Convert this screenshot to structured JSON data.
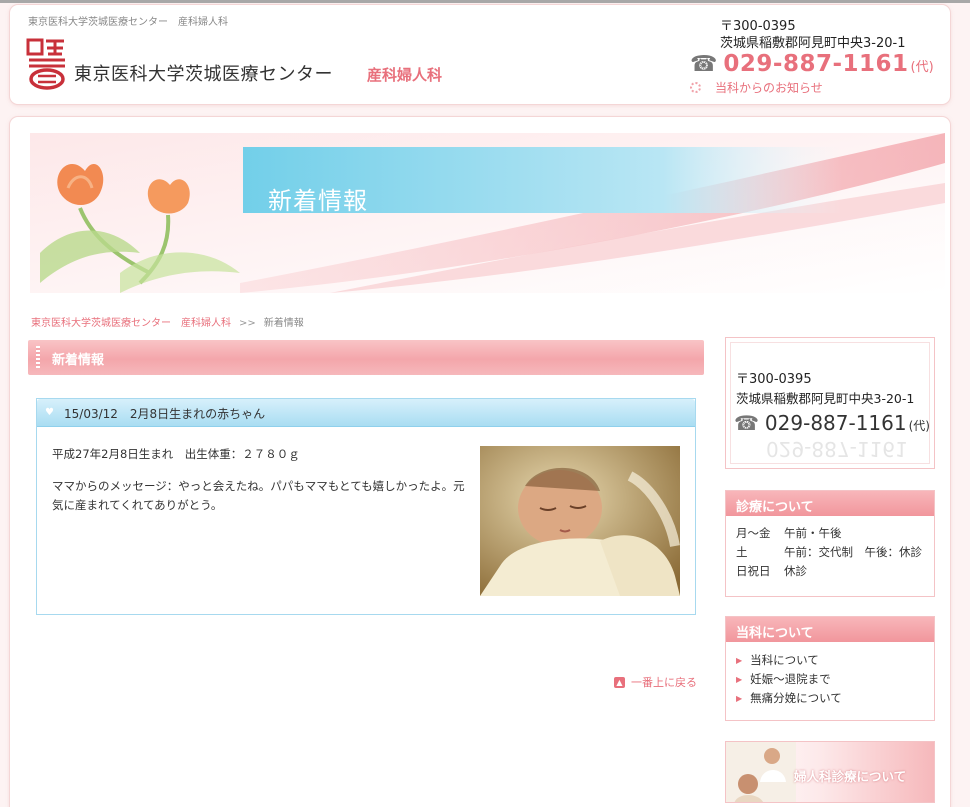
{
  "header": {
    "tagline": "東京医科大学茨城医療センター　産科婦人科",
    "site_name": "東京医科大学茨城医療センター",
    "dept_name": "産科婦人科",
    "postal": "〒300-0395",
    "address": "茨城県稲敷郡阿見町中央3-20-1",
    "phone": "029-887-1161",
    "phone_suffix": "(代)",
    "notice_link": "当科からのお知らせ"
  },
  "banner": {
    "title": "新着情報"
  },
  "breadcrumb": {
    "home": "東京医科大学茨城医療センター　産科婦人科",
    "sep": ">>",
    "current": "新着情報"
  },
  "section": {
    "title": "新着情報"
  },
  "post": {
    "title": "15/03/12　2月8日生まれの赤ちゃん",
    "line1": "平成27年2月8日生まれ　出生体重：２７８０ｇ",
    "line2": "ママからのメッセージ：やっと会えたね。パパもママもとても嬉しかったよ。元気に産まれてくれてありがとう。"
  },
  "to_top": "一番上に戻る",
  "sidebar": {
    "contact": {
      "postal": "〒300-0395",
      "address": "茨城県稲敷郡阿見町中央3-20-1",
      "phone": "029-887-1161",
      "phone_suffix": "(代)"
    },
    "hours": {
      "title": "診療について",
      "rows": [
        {
          "day": "月～金",
          "time": "午前・午後"
        },
        {
          "day": "土",
          "time": "午前：交代制　午後：休診"
        },
        {
          "day": "日祝日",
          "time": "休診"
        }
      ]
    },
    "about": {
      "title": "当科について",
      "items": [
        "当科について",
        "妊娠～退院まで",
        "無痛分娩について"
      ]
    },
    "gyne_banner": "婦人科診療について"
  },
  "colors": {
    "accent": "#e8707c",
    "blue": "#a9ddf2"
  }
}
